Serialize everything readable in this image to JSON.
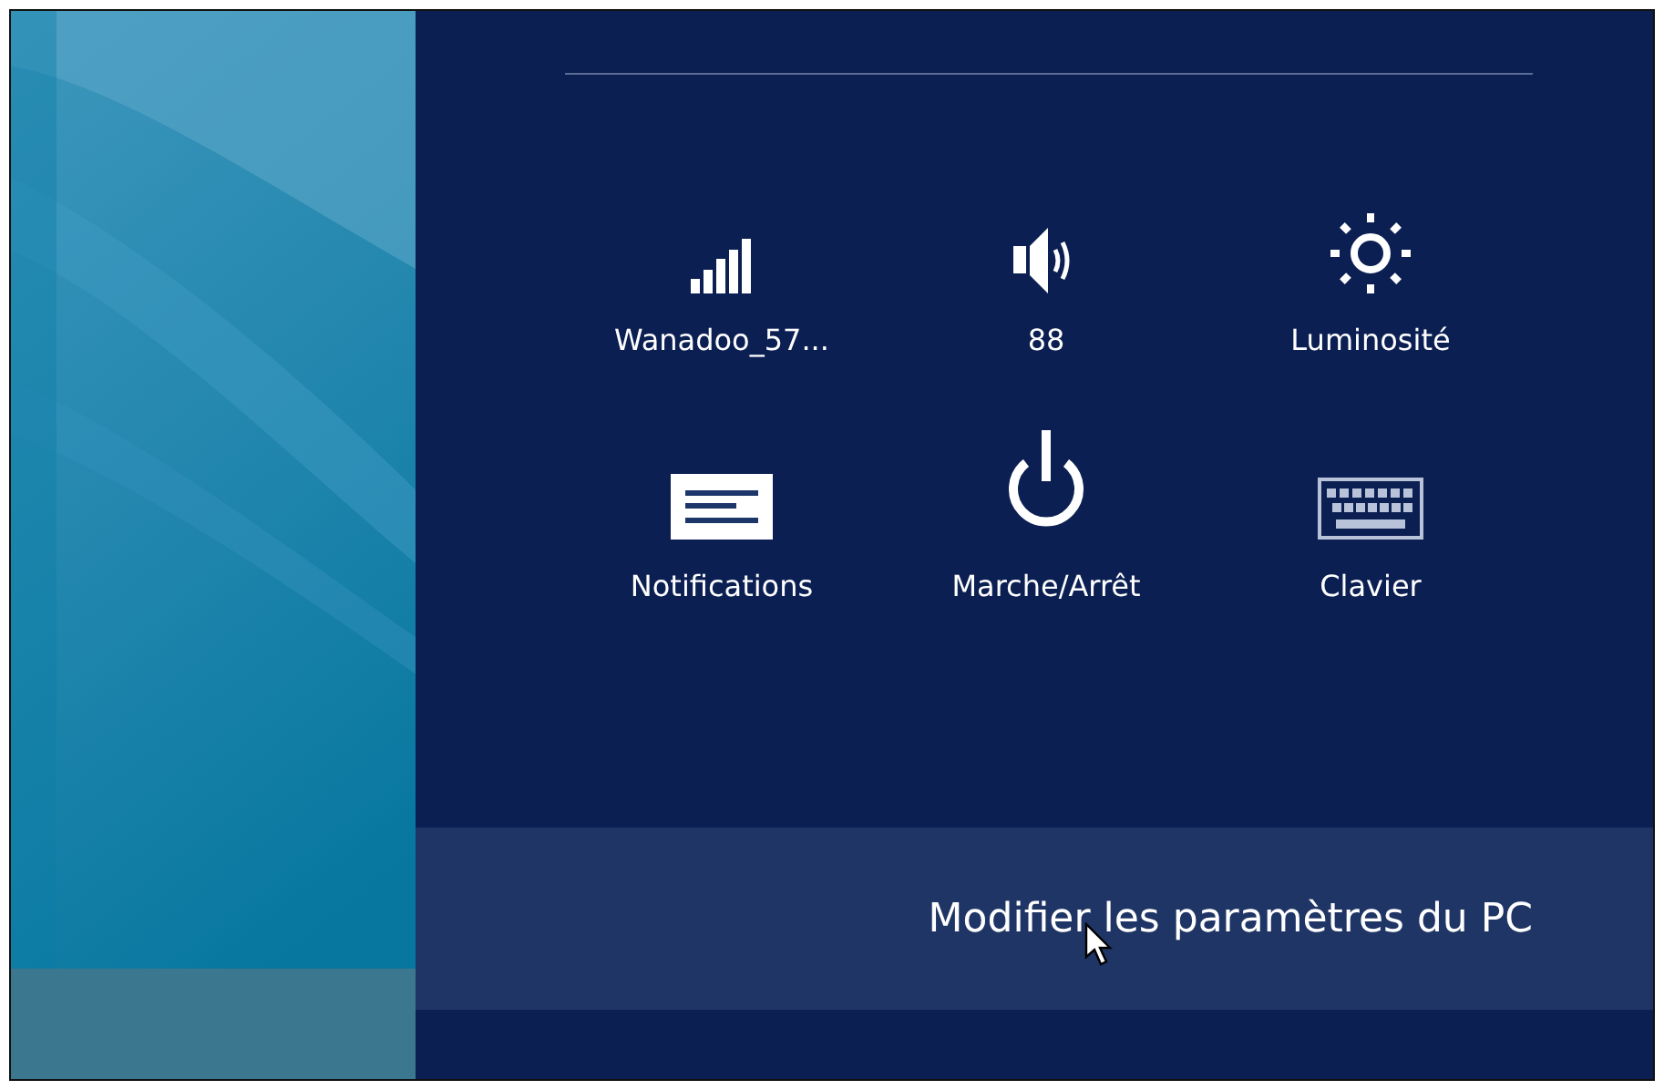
{
  "quick_settings": [
    {
      "kind": "signal",
      "label": "Wanadoo_57..."
    },
    {
      "kind": "volume",
      "label": "88"
    },
    {
      "kind": "brightness",
      "label": "Luminosité"
    },
    {
      "kind": "notifications",
      "label": "Notifications"
    },
    {
      "kind": "power",
      "label": "Marche/Arrêt"
    },
    {
      "kind": "keyboard",
      "label": "Clavier"
    }
  ],
  "change_pc_settings_link": "Modifier les paramètres du PC"
}
